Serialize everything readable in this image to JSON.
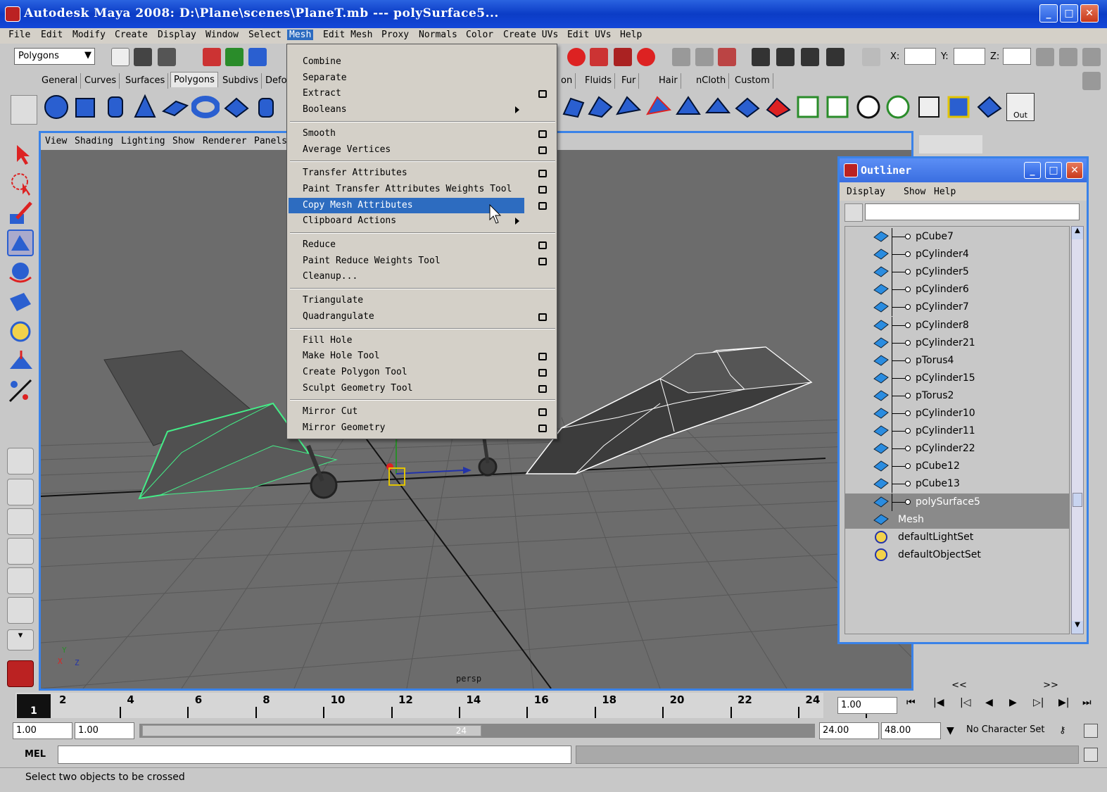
{
  "window": {
    "title": "Autodesk Maya 2008: D:\\Plane\\scenes\\PlaneT.mb    ---    polySurface5...",
    "minimize": "_",
    "maximize": "□",
    "close": "✕"
  },
  "menubar": [
    "File",
    "Edit",
    "Modify",
    "Create",
    "Display",
    "Window",
    "Select",
    "Mesh",
    "Edit Mesh",
    "Proxy",
    "Normals",
    "Color",
    "Create UVs",
    "Edit UVs",
    "Help"
  ],
  "menuset": "Polygons",
  "shelf_tabs": [
    "General",
    "Curves",
    "Surfaces",
    "Polygons",
    "Subdivs",
    "Defo",
    "on",
    "Fluids",
    "Fur",
    "Hair",
    "nCloth",
    "Custom"
  ],
  "shelf_out_label": "Out",
  "coord_labels": {
    "x": "X:",
    "y": "Y:",
    "z": "Z:"
  },
  "viewport": {
    "menu": [
      "View",
      "Shading",
      "Lighting",
      "Show",
      "Renderer",
      "Panels"
    ],
    "camera_label": "persp",
    "axis": {
      "x": "X",
      "y": "Y",
      "z": "Z"
    }
  },
  "mesh_menu": {
    "items": [
      {
        "label": "Combine",
        "option": false,
        "submenu": false
      },
      {
        "label": "Separate",
        "option": false,
        "submenu": false
      },
      {
        "label": "Extract",
        "option": true,
        "submenu": false
      },
      {
        "label": "Booleans",
        "option": false,
        "submenu": true
      },
      {
        "label": "Smooth",
        "option": true,
        "submenu": false
      },
      {
        "label": "Average Vertices",
        "option": true,
        "submenu": false
      },
      {
        "label": "Transfer Attributes",
        "option": true,
        "submenu": false
      },
      {
        "label": "Paint Transfer Attributes Weights Tool",
        "option": true,
        "submenu": false
      },
      {
        "label": "Copy Mesh Attributes",
        "option": true,
        "submenu": false,
        "highlighted": true
      },
      {
        "label": "Clipboard Actions",
        "option": false,
        "submenu": true
      },
      {
        "label": "Reduce",
        "option": true,
        "submenu": false
      },
      {
        "label": "Paint Reduce Weights Tool",
        "option": true,
        "submenu": false
      },
      {
        "label": "Cleanup...",
        "option": false,
        "submenu": false
      },
      {
        "label": "Triangulate",
        "option": false,
        "submenu": false
      },
      {
        "label": "Quadrangulate",
        "option": true,
        "submenu": false
      },
      {
        "label": "Fill Hole",
        "option": false,
        "submenu": false
      },
      {
        "label": "Make Hole Tool",
        "option": true,
        "submenu": false
      },
      {
        "label": "Create Polygon Tool",
        "option": true,
        "submenu": false
      },
      {
        "label": "Sculpt Geometry Tool",
        "option": true,
        "submenu": false
      },
      {
        "label": "Mirror Cut",
        "option": true,
        "submenu": false
      },
      {
        "label": "Mirror Geometry",
        "option": true,
        "submenu": false
      }
    ]
  },
  "outliner": {
    "title": "Outliner",
    "menu": [
      "Display",
      "Show",
      "Help"
    ],
    "items": [
      {
        "label": "pCube7",
        "kind": "mesh",
        "indent": 1
      },
      {
        "label": "pCylinder4",
        "kind": "mesh",
        "indent": 1
      },
      {
        "label": "pCylinder5",
        "kind": "mesh",
        "indent": 1
      },
      {
        "label": "pCylinder6",
        "kind": "mesh",
        "indent": 1
      },
      {
        "label": "pCylinder7",
        "kind": "mesh",
        "indent": 1
      },
      {
        "label": "pCylinder8",
        "kind": "mesh",
        "indent": 1
      },
      {
        "label": "pCylinder21",
        "kind": "mesh",
        "indent": 1
      },
      {
        "label": "pTorus4",
        "kind": "mesh",
        "indent": 1
      },
      {
        "label": "pCylinder15",
        "kind": "mesh",
        "indent": 1
      },
      {
        "label": "pTorus2",
        "kind": "mesh",
        "indent": 1
      },
      {
        "label": "pCylinder10",
        "kind": "mesh",
        "indent": 1
      },
      {
        "label": "pCylinder11",
        "kind": "mesh",
        "indent": 1
      },
      {
        "label": "pCylinder22",
        "kind": "mesh",
        "indent": 1
      },
      {
        "label": "pCube12",
        "kind": "mesh",
        "indent": 1
      },
      {
        "label": "pCube13",
        "kind": "mesh",
        "indent": 1
      },
      {
        "label": "polySurface5",
        "kind": "mesh",
        "indent": 1,
        "selected": true
      },
      {
        "label": "Mesh",
        "kind": "mesh",
        "indent": 0,
        "selected": true
      },
      {
        "label": "defaultLightSet",
        "kind": "set",
        "indent": 0
      },
      {
        "label": "defaultObjectSet",
        "kind": "set",
        "indent": 0
      }
    ]
  },
  "timeline": {
    "ticks": [
      "2",
      "4",
      "6",
      "8",
      "10",
      "12",
      "14",
      "16",
      "18",
      "20",
      "22",
      "24"
    ],
    "current_frame": "1",
    "current_time_field": "1.00",
    "range_start": "1.00",
    "playback_start": "1.00",
    "range_end_inner": "24",
    "playback_end": "24.00",
    "range_end": "48.00",
    "character_set": "No Character Set",
    "nav_prev": "<<",
    "nav_next": ">>"
  },
  "command_line": {
    "label": "MEL",
    "value": ""
  },
  "help_line": "Select two objects to be crossed",
  "colors": {
    "accent": "#3a82e8",
    "menu_highlight": "#2d6cc0",
    "titlebar": "#0b3cc6",
    "viewport_bg": "#4a4a4a",
    "wireframe_selected": "#44ee88"
  }
}
